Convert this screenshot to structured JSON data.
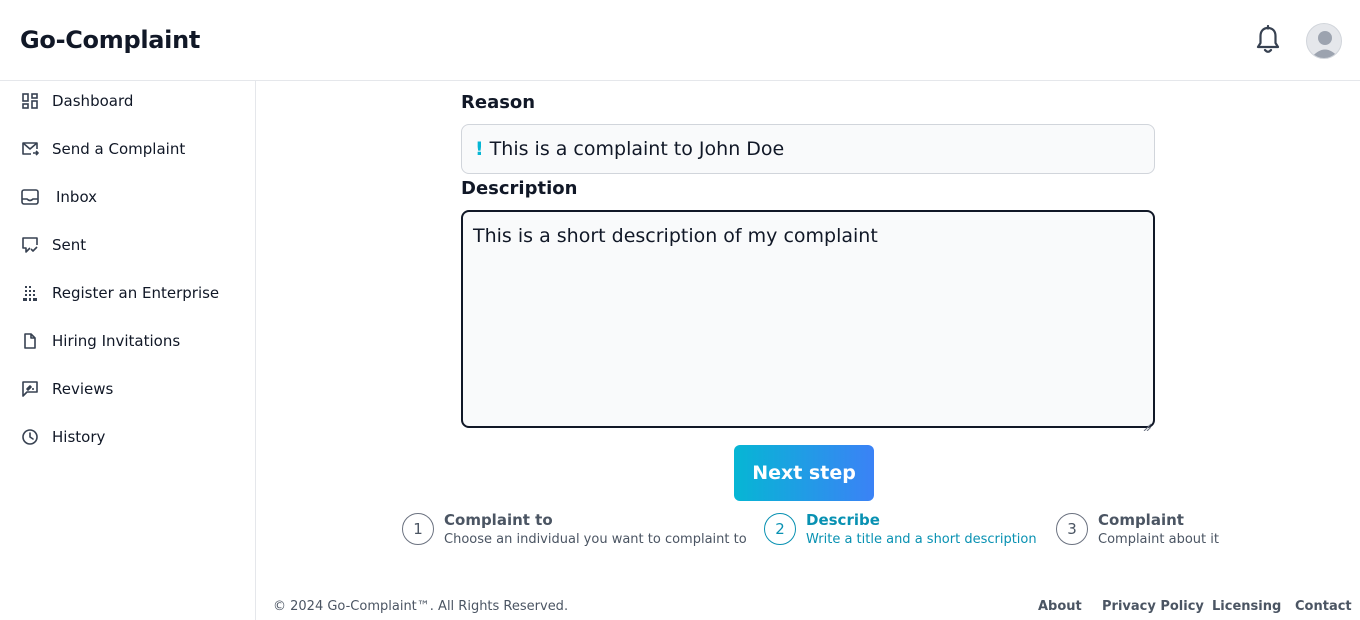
{
  "app": {
    "brand": "Go-Complaint"
  },
  "header": {
    "icons": [
      "bell-icon",
      "avatar-icon"
    ]
  },
  "sidebar": {
    "items": [
      {
        "label": "Dashboard",
        "icon": "grid-icon"
      },
      {
        "label": "Send a Complaint",
        "icon": "mail-send-icon"
      },
      {
        "label": "Inbox",
        "icon": "inbox-icon"
      },
      {
        "label": "Sent",
        "icon": "message-check-icon"
      },
      {
        "label": "Register an Enterprise",
        "icon": "buildings-icon"
      },
      {
        "label": "Hiring Invitations",
        "icon": "document-icon"
      },
      {
        "label": "Reviews",
        "icon": "review-icon"
      },
      {
        "label": "History",
        "icon": "clock-icon"
      }
    ]
  },
  "form": {
    "reason_label": "Reason",
    "reason_prefix": "!",
    "reason_value": "This is a complaint to John Doe",
    "description_label": "Description",
    "description_value": "This is a short description of my complaint",
    "next_label": "Next step"
  },
  "stepper": {
    "steps": [
      {
        "number": "1",
        "title": "Complaint to",
        "subtitle": "Choose an individual you want to complaint to",
        "active": false
      },
      {
        "number": "2",
        "title": "Describe",
        "subtitle": "Write a title and a short description",
        "active": true
      },
      {
        "number": "3",
        "title": "Complaint",
        "subtitle": "Complaint about it",
        "active": false
      }
    ]
  },
  "footer": {
    "copyright": "© 2024 Go-Complaint™. All Rights Reserved.",
    "links": [
      "About",
      "Privacy Policy",
      "Licensing",
      "Contact"
    ]
  },
  "colors": {
    "accent": "#0891b2",
    "gradient_start": "#06b6d4",
    "gradient_end": "#3b82f6"
  }
}
